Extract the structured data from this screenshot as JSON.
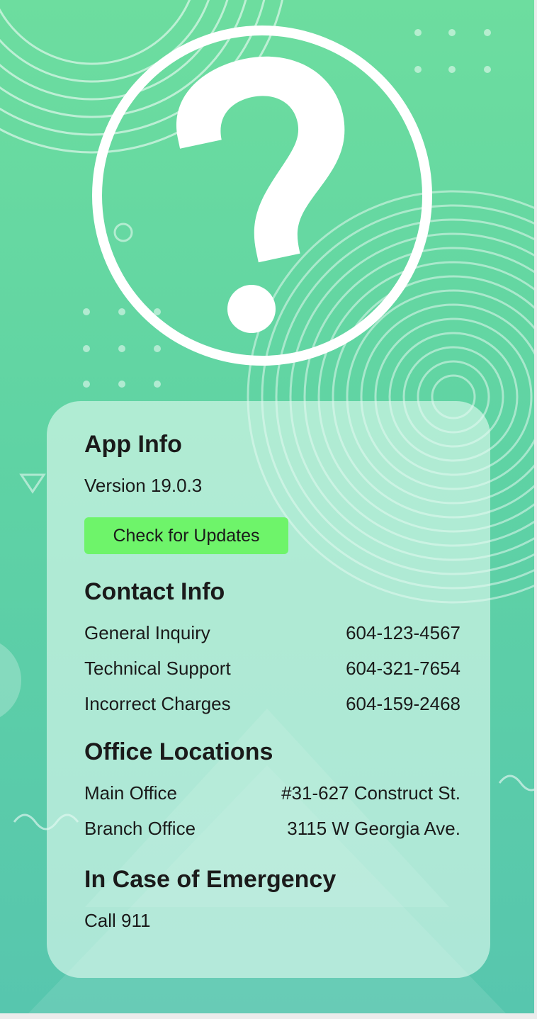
{
  "app_info": {
    "title": "App Info",
    "version": "Version 19.0.3",
    "update_button": "Check for Updates"
  },
  "contact_info": {
    "title": "Contact Info",
    "rows": [
      {
        "label": "General Inquiry",
        "value": "604-123-4567"
      },
      {
        "label": "Technical Support",
        "value": "604-321-7654"
      },
      {
        "label": "Incorrect Charges",
        "value": "604-159-2468"
      }
    ]
  },
  "office_locations": {
    "title": "Office Locations",
    "rows": [
      {
        "label": "Main Office",
        "value": "#31-627 Construct St."
      },
      {
        "label": "Branch Office",
        "value": "3115 W Georgia Ave."
      }
    ]
  },
  "emergency": {
    "title": "In Case of Emergency",
    "text": "Call 911"
  },
  "colors": {
    "background": "#6ddd9f",
    "card": "#e2faf0",
    "button": "#6ef46a",
    "text": "#1a1a1a"
  },
  "icons": {
    "hero": "question-mark-icon"
  }
}
